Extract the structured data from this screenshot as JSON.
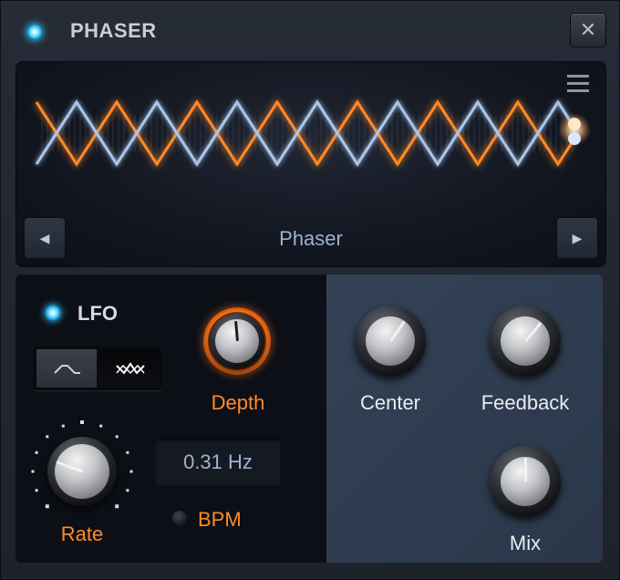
{
  "plugin": {
    "title": "PHASER",
    "power_on": true,
    "close_glyph": "✕"
  },
  "display": {
    "preset_name": "Phaser",
    "prev_glyph": "◀",
    "next_glyph": "▶",
    "menu_icon": "hamburger-menu-icon"
  },
  "lfo": {
    "label": "LFO",
    "enabled": true,
    "waveforms": [
      "triangle",
      "random-stepped"
    ],
    "selected_waveform": "random-stepped",
    "rate": {
      "label": "Rate",
      "value": 0.31
    },
    "depth": {
      "label": "Depth"
    },
    "frequency_readout": "0.31 Hz",
    "bpm": {
      "label": "BPM",
      "enabled": false
    }
  },
  "main": {
    "center": {
      "label": "Center"
    },
    "feedback": {
      "label": "Feedback"
    },
    "mix": {
      "label": "Mix"
    }
  },
  "colors": {
    "accent_orange": "#ff8a2a",
    "wave_blue": "#a9c6ea",
    "led_blue": "#3cc8ff",
    "panel_blue": "#344257"
  }
}
